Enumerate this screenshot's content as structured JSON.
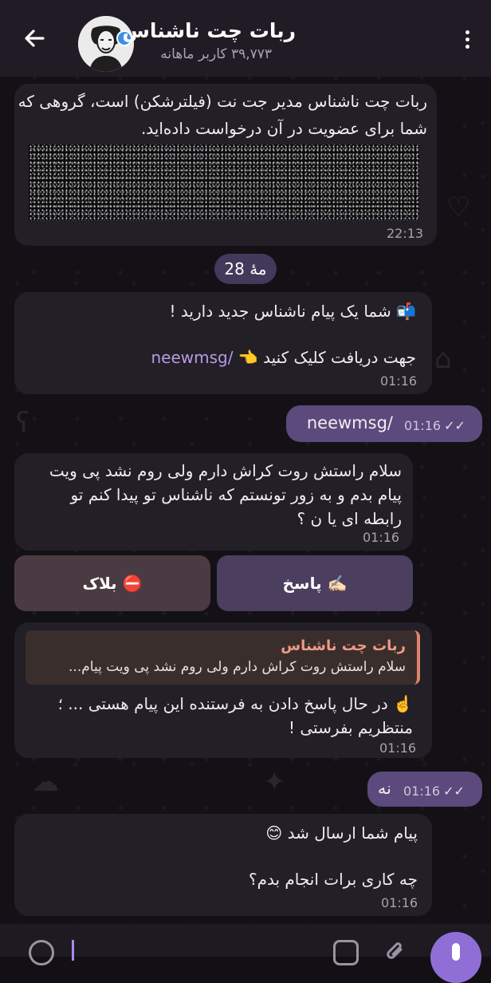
{
  "header": {
    "title": "ربات چت ناشناس",
    "subtitle": "۳۹,۷۷۳ کاربر ماهانه",
    "back_icon": "arrow-left-icon",
    "menu_icon": "more-vertical-icon"
  },
  "messages": [
    {
      "line1": "ربات چت ناشناس مدیر جت نت (فیلترشکن) است، گروهی که",
      "line2": "شما برای عضویت در آن درخواست داده‌اید.",
      "time": "22:13"
    },
    {
      "line1": "📬 شما یک پیام ناشناس جدید دارید !",
      "line2_prefix": "جهت دریافت کلیک کنید 👈 ",
      "line2_link": "/neewmsg",
      "time": "01:16"
    },
    {
      "text": "/neewmsg",
      "time": "01:16"
    },
    {
      "line1": "سلام راستش روت کراش دارم ولی روم نشد پی ویت",
      "line2": "پیام بدم و به زور تونستم که ناشناس تو پیدا کنم تو",
      "line3": "رابطه ای یا ن ؟",
      "time": "01:16"
    },
    {
      "quote_name": "ربات چت ناشناس",
      "quote_text": "سلام راستش روت کراش دارم ولی روم نشد پی ویت پیام...",
      "line1": "☝️ در حال پاسخ دادن به فرستنده این پیام هستی ... ؛",
      "line2": "منتظریم بفرستی !",
      "time": "01:16"
    },
    {
      "text": "نه",
      "time": "01:16"
    },
    {
      "line1": "پیام شما ارسال شد 😊",
      "line2": "چه کاری برات انجام بدم؟",
      "time": "01:16"
    }
  ],
  "date_chip": "28 مهٔ",
  "buttons": {
    "reply": "✍🏻 پاسخ",
    "block": "⛔ بلاک"
  },
  "colors": {
    "incoming_bubble": "#231f27",
    "outgoing_bubble": "#5d4a7c",
    "accent": "#8f6fd6",
    "link": "#b69be3"
  }
}
